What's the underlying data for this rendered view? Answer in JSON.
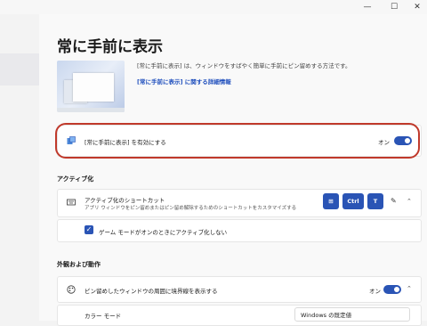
{
  "window": {
    "minimize_glyph": "—",
    "maximize_glyph": "☐",
    "close_glyph": "✕"
  },
  "page": {
    "title": "常に手前に表示"
  },
  "hero": {
    "description": "[常に手前に表示] は、ウィンドウをすばやく簡単に手前にピン留めする方法です。",
    "link": "[常に手前に表示] に関する詳細情報"
  },
  "enable_card": {
    "label": "[常に手前に表示] を有効にする",
    "toggle_state": "オン",
    "icon": "pinned-window-icon"
  },
  "activation": {
    "section_title": "アクティブ化",
    "shortcut_label": "アクティブ化のショートカット",
    "shortcut_desc": "アプリ ウィンドウをピン留めまたはピン留め解除するためのショートカットをカスタマイズする",
    "keys": [
      "⊞",
      "Ctrl",
      "T"
    ],
    "game_mode_label": "ゲーム モードがオンのときにアクティブ化しない"
  },
  "appearance": {
    "section_title": "外観および動作",
    "border_label": "ピン留めしたウィンドウの周囲に境界線を表示する",
    "border_toggle_state": "オン",
    "color_mode_label": "カラー モード",
    "color_mode_value": "Windows の既定値"
  },
  "colors": {
    "accent": "#2a54b5",
    "highlight_ring": "#c0392b"
  }
}
